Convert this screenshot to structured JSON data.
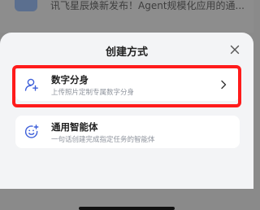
{
  "background": {
    "notification_text": "讯飞星辰焕新发布！Agent规模化应用的通..."
  },
  "sheet": {
    "title": "创建方式",
    "options": [
      {
        "title": "数字分身",
        "subtitle": "上传照片定制专属数字分身",
        "icon": "person-add-icon",
        "selected": true
      },
      {
        "title": "通用智能体",
        "subtitle": "一句话创建完成指定任务的智能体",
        "icon": "smiley-plus-icon",
        "selected": false
      }
    ]
  },
  "colors": {
    "accent": "#3d5fd9",
    "highlight": "#ff1b1b",
    "sheet_bg": "#f3f4f6"
  }
}
